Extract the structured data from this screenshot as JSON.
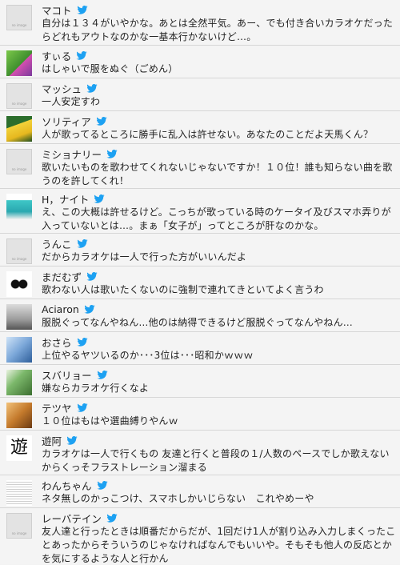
{
  "tweets": [
    {
      "name": "マコト",
      "text": "自分は１３４がいやかな。あとは全然平気。あー、でも付き合いカラオケだったらどれもアウトなのかな一基本行かないけど…。"
    },
    {
      "name": "すぃる",
      "text": "はしゃいで服をぬぐ（ごめん）"
    },
    {
      "name": "マッシュ",
      "text": "一人安定すわ"
    },
    {
      "name": "ソリティア",
      "text": "人が歌ってるところに勝手に乱入は許せない。あなたのことだよ天馬くん？"
    },
    {
      "name": "ミショナリー",
      "text": "歌いたいものを歌わせてくれないじゃないですか！１０位！誰も知らない曲を歌うのを許してくれ！"
    },
    {
      "name": "H，ナイト",
      "text": "え、この大概は許せるけど。こっちが歌っている時のケータイ及びスマホ弄りが入っていないとは…。まぁ「女子が」ってところが肝なのかな。"
    },
    {
      "name": "うんこ",
      "text": "だからカラオケは一人で行った方がいいんだよ"
    },
    {
      "name": "まだむず",
      "text": "歌わない人は歌いたくないのに強制で連れてきといてよく言うわ"
    },
    {
      "name": "Aciaron",
      "text": "服脱ぐってなんやねん…他のは納得できるけど服脱ぐってなんやねん…"
    },
    {
      "name": "おさら",
      "text": "上位やるヤツいるのか･･･3位は･･･昭和かｗｗｗ"
    },
    {
      "name": "スバリョー",
      "text": "嫌ならカラオケ行くなよ"
    },
    {
      "name": "テツヤ",
      "text": "１０位はもはや選曲縛りやんｗ"
    },
    {
      "name": "遊阿",
      "text": "カラオケは一人で行くもの 友達と行くと普段の１/人数のペースでしか歌えないからくっそフラストレーション溜まる"
    },
    {
      "name": "わんちゃん",
      "text": "ネタ無しのかっこつけ、スマホしかいじらない　これやめーや"
    },
    {
      "name": "レーバテイン",
      "text": "友人達と行ったときは順番だからだが、1回だけ1人が割り込み入力しまくったことあったからそういうのじゃなければなんでもいいや。そもそも他人の反応とかを気にするような人と行かん"
    }
  ],
  "avatar_glyph_yu": "遊",
  "colors": {
    "row_bg": "#f4f4f4",
    "divider": "#d6d6d6",
    "twitter_blue": "#1da1f2",
    "text": "#222222"
  }
}
